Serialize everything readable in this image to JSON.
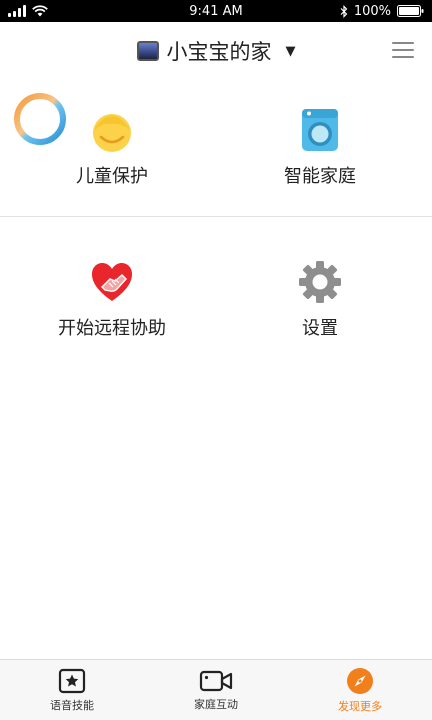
{
  "status_bar": {
    "time": "9:41 AM",
    "battery": "100%"
  },
  "header": {
    "title": "小宝宝的家",
    "home_icon": "home-thumbnail-icon",
    "caret_icon": "caret-down-icon",
    "menu_icon": "hamburger-menu-icon"
  },
  "features": [
    {
      "label": "儿童保护",
      "icon": "child-face-icon"
    },
    {
      "label": "智能家庭",
      "icon": "washing-machine-icon"
    },
    {
      "label": "开始远程协助",
      "icon": "heart-handshake-icon"
    },
    {
      "label": "设置",
      "icon": "gear-icon"
    }
  ],
  "tabbar": {
    "tabs": [
      {
        "label": "语音技能",
        "icon": "star-card-icon",
        "active": false
      },
      {
        "label": "家庭互动",
        "icon": "video-camera-icon",
        "active": false
      },
      {
        "label": "发现更多",
        "icon": "compass-icon",
        "active": true
      }
    ]
  },
  "colors": {
    "accent": "#f07f1c",
    "status_bar_bg": "#000000",
    "divider": "#e2e2e2"
  }
}
